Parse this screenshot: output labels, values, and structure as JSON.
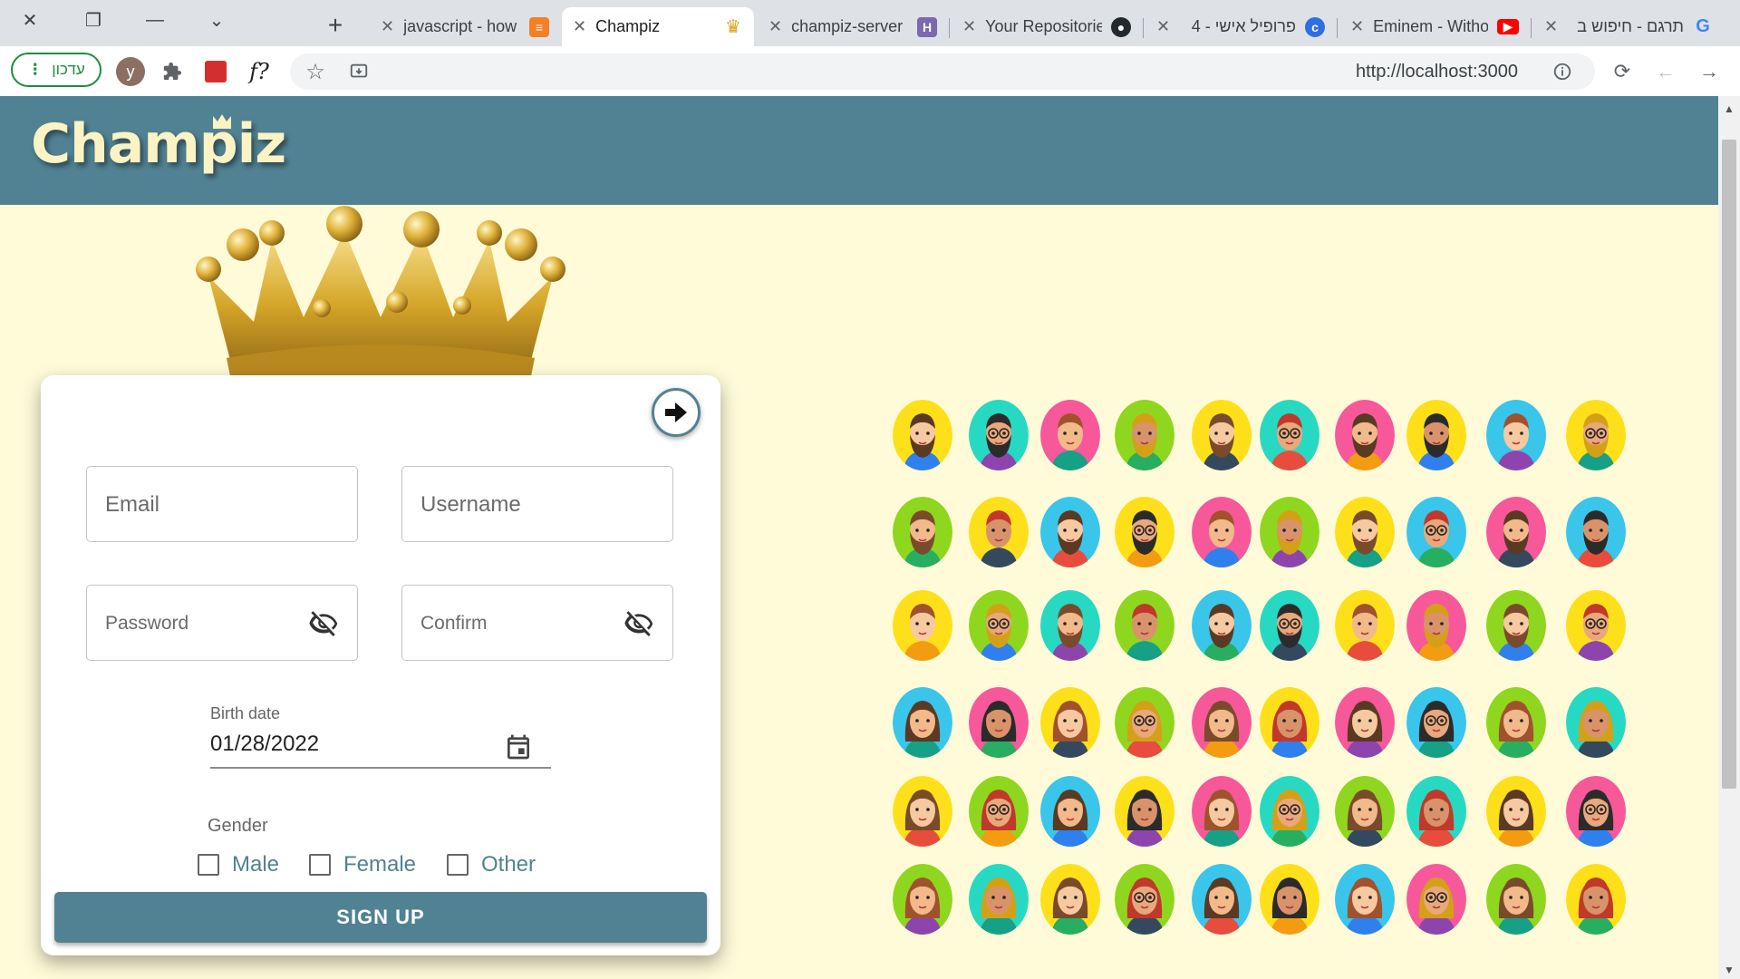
{
  "browser": {
    "tabs": [
      {
        "title": "javascript - how",
        "favicon": "stackoverflow-icon"
      },
      {
        "title": "Champiz",
        "favicon": "crown-icon",
        "active": true
      },
      {
        "title": "champiz-server",
        "favicon": "heroku-icon"
      },
      {
        "title": "Your Repositories",
        "favicon": "github-icon"
      },
      {
        "title": "פרופיל אישי - 4",
        "favicon": "profile-icon"
      },
      {
        "title": "Eminem - Without",
        "favicon": "youtube-icon"
      },
      {
        "title": "תרגם - חיפוש ב",
        "favicon": "google-icon"
      }
    ],
    "update_label": "עדכון",
    "profile_initial": "y",
    "extension_fx": "f?",
    "url": "http://localhost:3000"
  },
  "app": {
    "logo": "Champiz"
  },
  "form": {
    "email_placeholder": "Email",
    "username_placeholder": "Username",
    "password_placeholder": "Password",
    "confirm_placeholder": "Confirm",
    "birth_label": "Birth date",
    "birth_value": "01/28/2022",
    "gender_label": "Gender",
    "gender_options": [
      "Male",
      "Female",
      "Other"
    ],
    "submit_label": "SIGN UP"
  },
  "colors": {
    "header": "#518293",
    "page_background": "#fffbd9",
    "logo_text": "#fbf3c4",
    "avatar_backgrounds": [
      "#fde01a",
      "#27d9c2",
      "#f7589a",
      "#8fd61f",
      "#39c6ea"
    ]
  },
  "avatar_grid": {
    "rows": 6,
    "cols": 10
  }
}
